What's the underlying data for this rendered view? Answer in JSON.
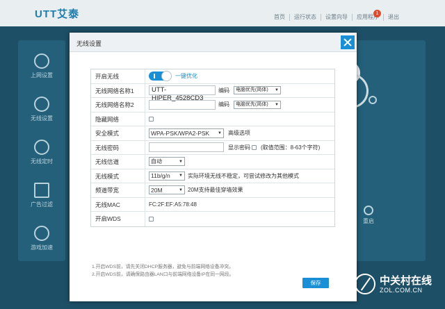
{
  "app": {
    "logo_text": "UTT艾泰",
    "nav": [
      "首页",
      "运行状态",
      "设置向导",
      "应用程序",
      "退出"
    ],
    "badge_count": "1",
    "sidebar": [
      {
        "label": "上网设置",
        "icon": "globe-icon"
      },
      {
        "label": "无线设置",
        "icon": "wifi-icon"
      },
      {
        "label": "无线定时",
        "icon": "stopwatch-icon"
      },
      {
        "label": "广告过滤",
        "icon": "funnel-icon"
      },
      {
        "label": "游戏加速",
        "icon": "gamepad-icon"
      }
    ],
    "reboot_label": "重启"
  },
  "modal": {
    "title": "无线设置",
    "rows": {
      "enable_wireless": {
        "label": "开启无线",
        "toggle_on": true,
        "link": "一键优化"
      },
      "ssid1": {
        "label": "无线网络名称1",
        "value": "UTT-HIPER_4528CD3",
        "enc_label": "编码",
        "enc_value": "电脑优先(简体)"
      },
      "ssid2": {
        "label": "无线网络名称2",
        "value": "",
        "enc_label": "编码",
        "enc_value": "电脑优先(简体)"
      },
      "hidden": {
        "label": "隐藏网络",
        "checked": false
      },
      "security": {
        "label": "安全模式",
        "value": "WPA-PSK/WPA2-PSK",
        "advanced": "高级选项"
      },
      "password": {
        "label": "无线密码",
        "value": "",
        "show_label": "显示密码",
        "range_hint": "(取值范围：8-63个字符)"
      },
      "channel": {
        "label": "无线信道",
        "value": "自动"
      },
      "mode": {
        "label": "无线模式",
        "value": "11b/g/n",
        "hint": "实际环境无线不稳定，可尝试修改为其他模式"
      },
      "bandwidth": {
        "label": "频道带宽",
        "value": "20M",
        "hint": "20M支持最佳穿墙效果"
      },
      "mac": {
        "label": "无线MAC",
        "value": "FC:2F:EF:A5:78:48"
      },
      "wds": {
        "label": "开启WDS",
        "checked": false
      }
    },
    "notes": [
      "1.开启WDS前，请先关闭DHCP服务器，避免与前端网络设备冲突。",
      "2.开启WDS前，请确保路由器LAN口与前端网络设备IP在同一网段。"
    ],
    "save_label": "保存"
  },
  "watermark": {
    "cn": "中关村在线",
    "en": "ZOL.COM.CN"
  },
  "colors": {
    "accent": "#1a8fd6",
    "background": "#1d4f66"
  }
}
